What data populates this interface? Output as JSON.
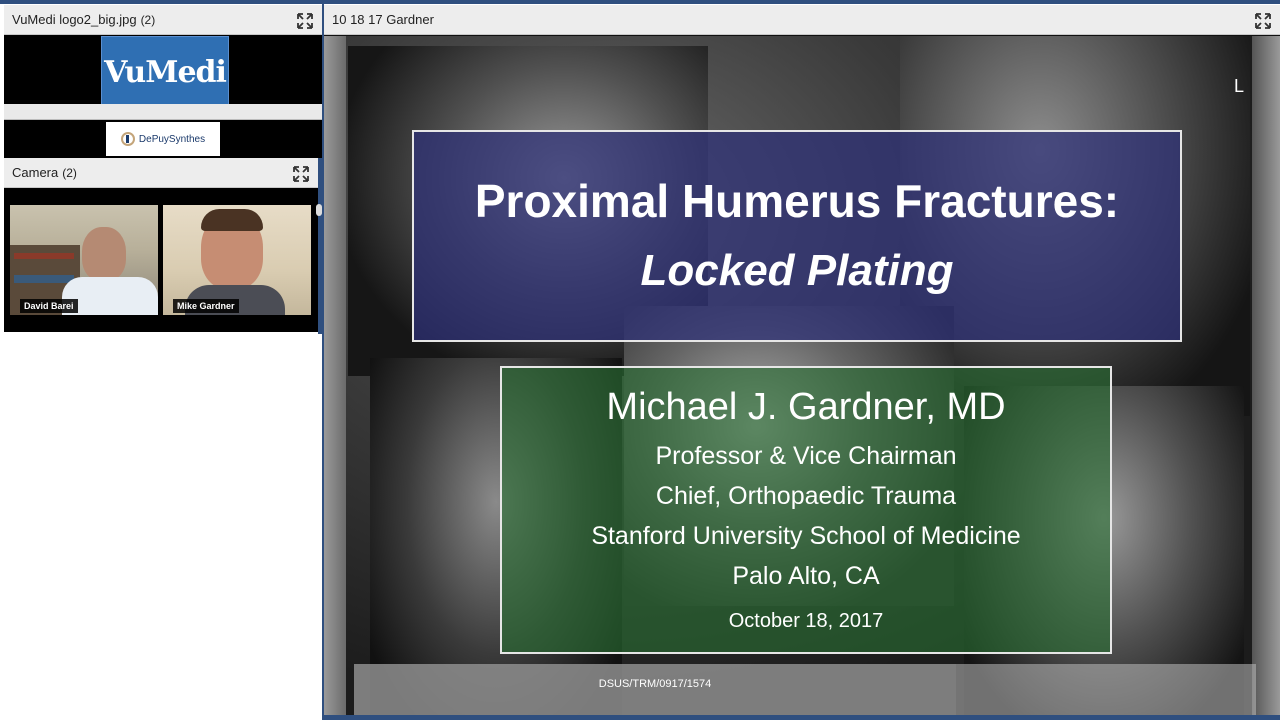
{
  "logo_pod": {
    "title": "VuMedi logo2_big.jpg",
    "count": "(2)",
    "logo_text": "VuMedi"
  },
  "sponsor": {
    "logo_text": "DePuySynthes"
  },
  "camera_pod": {
    "title": "Camera",
    "count": "(2)",
    "participants": [
      {
        "name": "David Barei"
      },
      {
        "name": "Mike Gardner"
      }
    ]
  },
  "share_pod": {
    "title": "10 18 17 Gardner"
  },
  "slide": {
    "side_marker": "L",
    "title_line1": "Proximal Humerus Fractures:",
    "title_line2": "Locked Plating",
    "author_name": "Michael J. Gardner, MD",
    "author_lines": [
      "Professor & Vice Chairman",
      "Chief, Orthopaedic Trauma",
      "Stanford University School of Medicine",
      "Palo Alto, CA"
    ],
    "date": "October 18, 2017",
    "doc_code": "DSUS/TRM/0917/1574"
  },
  "colors": {
    "frame_blue": "#2f4f7f",
    "title_box": "#2e3078",
    "author_box": "#286e32",
    "vumedi_blue": "#2f6fb3"
  }
}
